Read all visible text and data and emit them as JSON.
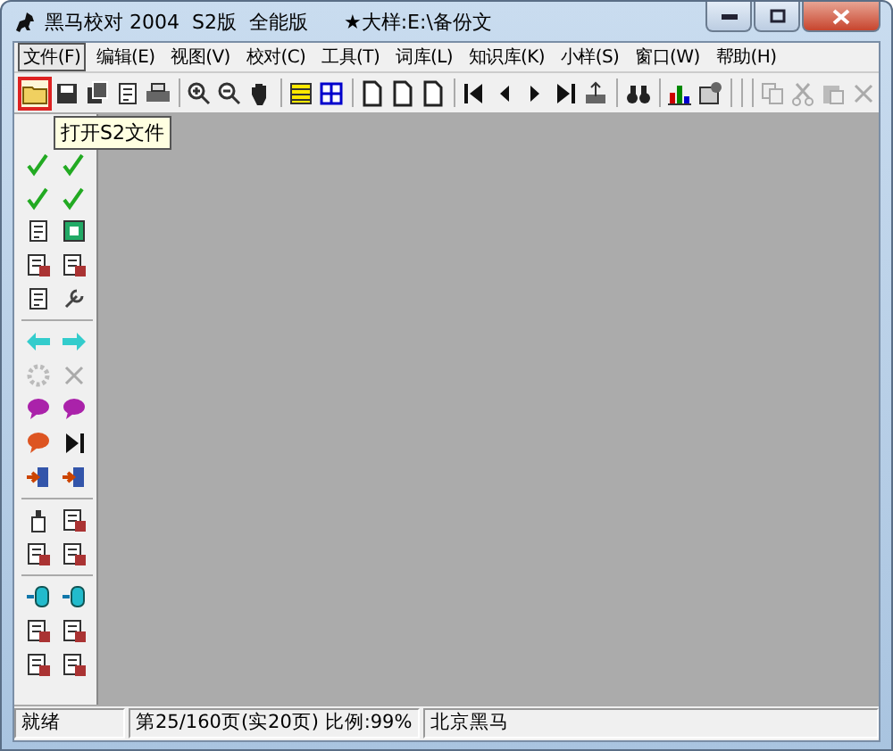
{
  "window": {
    "title": "黑马校对 2004  S2版  全能版",
    "document": "★大样:E:\\备份文"
  },
  "menu": [
    {
      "label": "文件(F)",
      "selected": true
    },
    {
      "label": "编辑(E)",
      "selected": false
    },
    {
      "label": "视图(V)",
      "selected": false
    },
    {
      "label": "校对(C)",
      "selected": false
    },
    {
      "label": "工具(T)",
      "selected": false
    },
    {
      "label": "词库(L)",
      "selected": false
    },
    {
      "label": "知识库(K)",
      "selected": false
    },
    {
      "label": "小样(S)",
      "selected": false
    },
    {
      "label": "窗口(W)",
      "selected": false
    },
    {
      "label": "帮助(H)",
      "selected": false
    }
  ],
  "tooltip": "打开S2文件",
  "status_bar": [
    "就绪",
    "第25/160页(实20页) 比例:99%",
    "北京黑马"
  ]
}
